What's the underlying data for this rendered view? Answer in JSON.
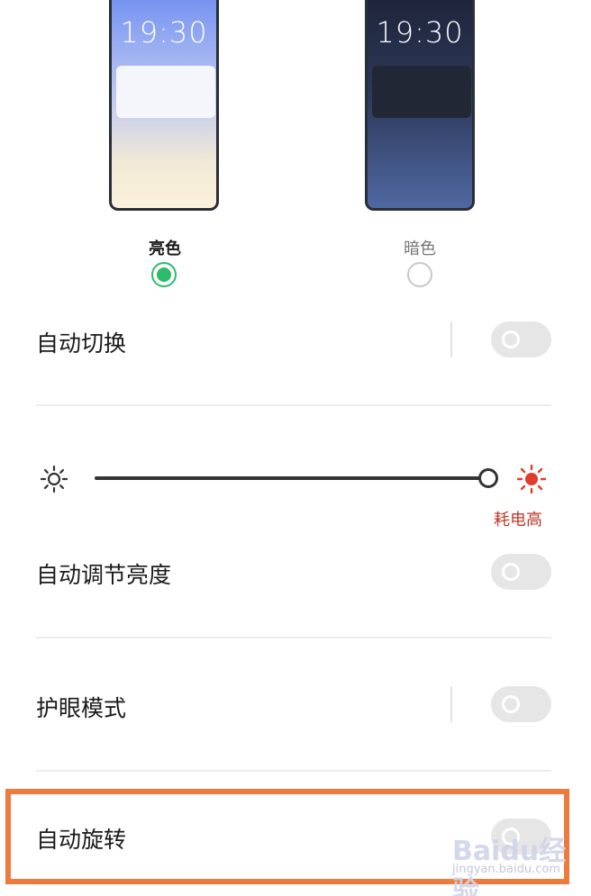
{
  "theme": {
    "light": {
      "time": "19:30",
      "label": "亮色",
      "selected": true
    },
    "dark": {
      "time": "19:30",
      "label": "暗色",
      "selected": false
    }
  },
  "settings": {
    "auto_switch": {
      "label": "自动切换",
      "enabled": false
    },
    "auto_brightness": {
      "label": "自动调节亮度",
      "enabled": false
    },
    "eye_care": {
      "label": "护眼模式",
      "enabled": false
    },
    "auto_rotate": {
      "label": "自动旋转",
      "enabled": false
    }
  },
  "brightness": {
    "level": 1.0,
    "high_power_label": "耗电高"
  },
  "colors": {
    "accent_green": "#2dbb6a",
    "warning_red": "#c0392b",
    "highlight_orange": "#ee7a3d"
  },
  "watermark": {
    "brand": "Baidu经验",
    "url": "jingyan.baidu.com"
  }
}
